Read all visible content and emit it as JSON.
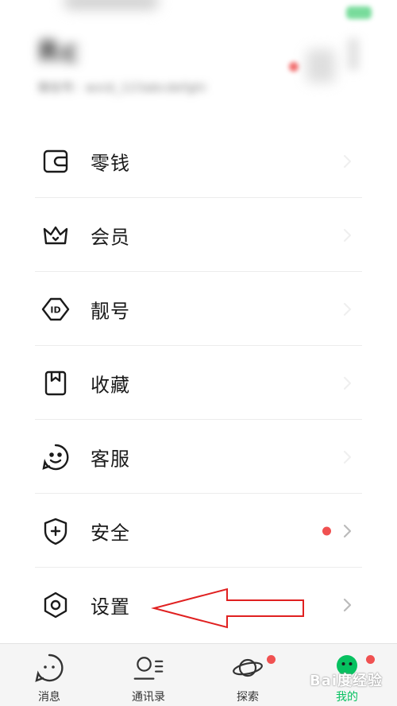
{
  "header": {
    "name": "Rc",
    "subtitle": "微信号：wxid_123abcdefghi"
  },
  "menu": {
    "items": [
      {
        "label": "零钱",
        "icon": "wallet-icon"
      },
      {
        "label": "会员",
        "icon": "crown-icon"
      },
      {
        "label": "靓号",
        "icon": "id-badge-icon"
      },
      {
        "label": "收藏",
        "icon": "bookmark-icon"
      },
      {
        "label": "客服",
        "icon": "service-face-icon"
      },
      {
        "label": "安全",
        "icon": "shield-plus-icon",
        "badge": true
      },
      {
        "label": "设置",
        "icon": "hexagon-settings-icon"
      }
    ]
  },
  "tabbar": {
    "tabs": [
      {
        "label": "消息",
        "icon": "chat-bubble-icon"
      },
      {
        "label": "通讯录",
        "icon": "contacts-icon"
      },
      {
        "label": "探索",
        "icon": "planet-icon",
        "badge": true
      },
      {
        "label": "我的",
        "icon": "me-face-icon",
        "badge": true,
        "active": true
      }
    ]
  },
  "colors": {
    "accent": "#07c160",
    "badge": "#f05151",
    "annotation": "#e02020"
  },
  "watermark": "Bai度经验"
}
